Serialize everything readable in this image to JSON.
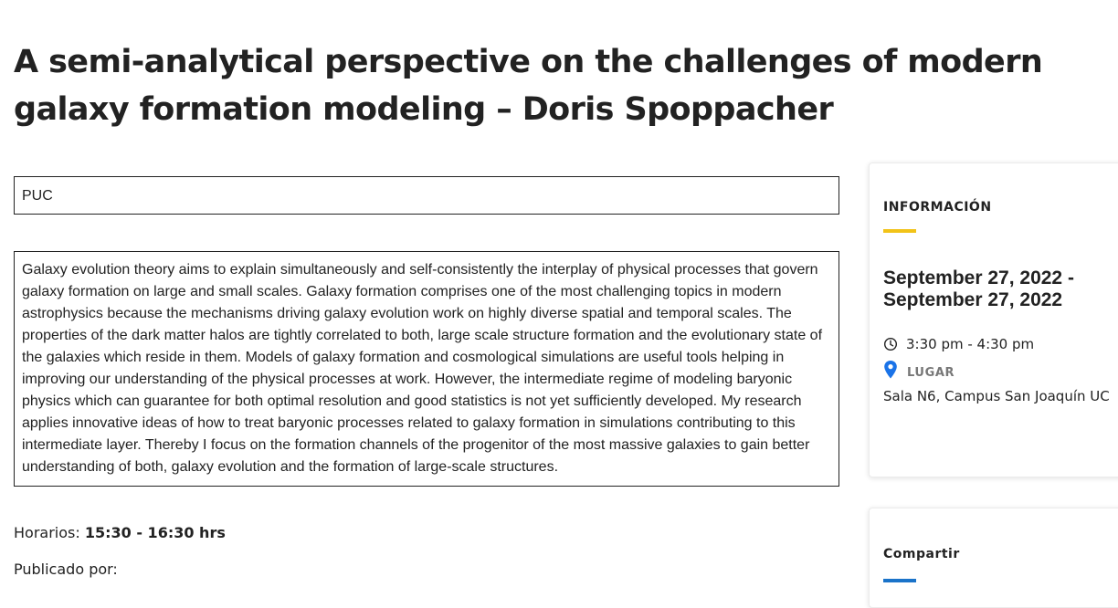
{
  "page": {
    "title": "A semi-analytical perspective on the challenges of modern galaxy formation modeling – Doris Spoppacher"
  },
  "event": {
    "institution": "PUC",
    "abstract": "Galaxy evolution theory aims to explain simultaneously and self-consistently the interplay of physical processes that govern galaxy formation on large and small scales. Galaxy formation comprises one of the most challenging topics in modern astrophysics because the mechanisms driving galaxy evolution work on highly diverse spatial and temporal scales. The properties of the dark matter halos are tightly correlated to both, large scale structure formation and the evolutionary state of the galaxies which reside in them. Models of galaxy formation and cosmological simulations are useful tools helping in improving our understanding of the physical processes at work. However, the intermediate regime of modeling baryonic physics which can guarantee for both optimal resolution and good statistics is not yet sufficiently developed. My research applies innovative ideas of how to treat baryonic processes related to galaxy formation in simulations contributing to this intermediate layer. Thereby I focus on the formation channels of the progenitor of the most massive galaxies to gain better understanding of both, galaxy evolution and the formation of large-scale structures.",
    "schedule_label": "Horarios:",
    "schedule_value": "15:30 - 16:30 hrs",
    "published_label": "Publicado por:"
  },
  "sidebar": {
    "info": {
      "heading": "INFORMACIÓN",
      "date_range": "September 27, 2022 - September 27, 2022",
      "time": "3:30 pm - 4:30 pm",
      "time_icon": "clock-icon",
      "location_label": "LUGAR",
      "location_icon": "map-pin-icon",
      "location": "Sala N6, Campus San Joaquín UC"
    },
    "share": {
      "heading": "Compartir"
    }
  },
  "colors": {
    "info_accent": "#f2c318",
    "share_accent": "#1a73c9",
    "pin": "#1a73e8",
    "text": "#222222",
    "muted_label": "#777777"
  }
}
